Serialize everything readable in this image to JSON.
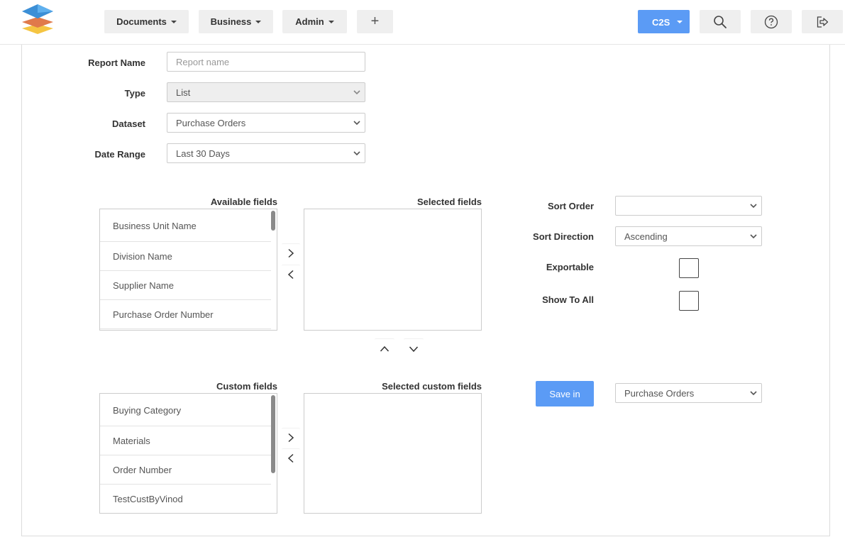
{
  "nav": {
    "documents": "Documents",
    "business": "Business",
    "admin": "Admin",
    "add": "+",
    "user_menu": "C2S"
  },
  "form": {
    "report_name_label": "Report Name",
    "report_name_placeholder": "Report name",
    "type_label": "Type",
    "type_value": "List",
    "dataset_label": "Dataset",
    "dataset_value": "Purchase Orders",
    "date_range_label": "Date Range",
    "date_range_value": "Last 30 Days"
  },
  "fields": {
    "available_title": "Available fields",
    "selected_title": "Selected fields",
    "available": [
      "Business Unit Name",
      "Division Name",
      "Supplier Name",
      "Purchase Order Number"
    ],
    "custom_title": "Custom fields",
    "selected_custom_title": "Selected custom fields",
    "custom": [
      "Buying Category",
      "Materials",
      "Order Number",
      "TestCustByVinod"
    ]
  },
  "options": {
    "sort_order_label": "Sort Order",
    "sort_order_value": "",
    "sort_direction_label": "Sort Direction",
    "sort_direction_value": "Ascending",
    "exportable_label": "Exportable",
    "show_to_all_label": "Show To All",
    "save_in_label": "Save in",
    "save_in_value": "Purchase Orders"
  },
  "colors": {
    "accent": "#5b9bf5"
  }
}
